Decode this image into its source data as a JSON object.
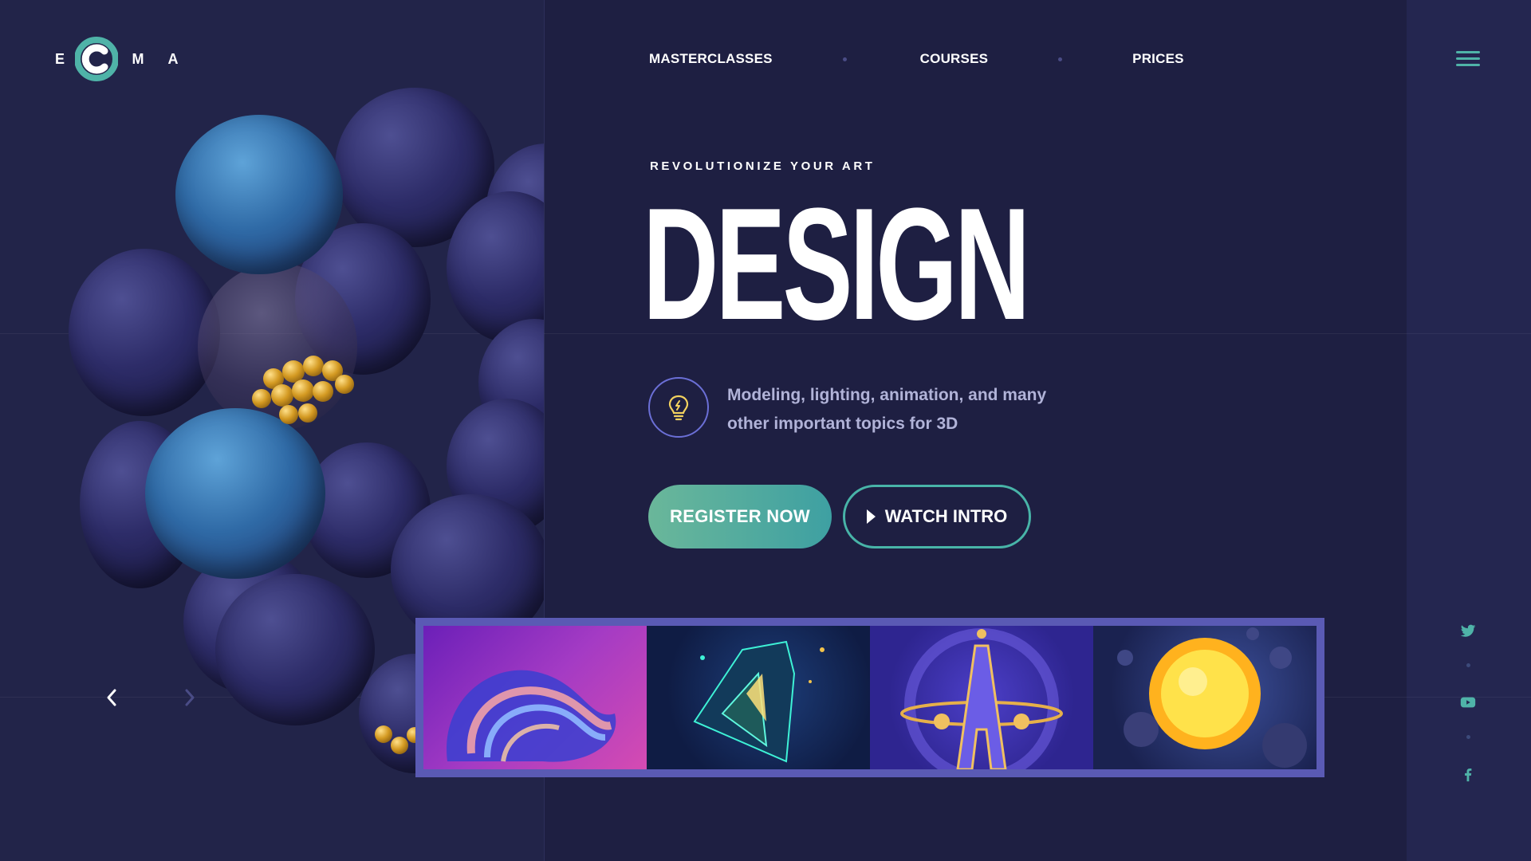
{
  "logo": {
    "letters": [
      "E",
      "M",
      "A"
    ]
  },
  "nav": {
    "items": [
      {
        "label": "MASTERCLASSES"
      },
      {
        "label": "COURSES"
      },
      {
        "label": "PRICES"
      }
    ]
  },
  "hero": {
    "eyebrow": "REVOLUTIONIZE YOUR ART",
    "title": "DESIGN",
    "description": "Modeling, lighting, animation, and many other important topics for 3D",
    "register_label": "REGISTER NOW",
    "watch_label": "WATCH INTRO"
  },
  "gallery": {
    "thumbnails": [
      "abstract-ribbon",
      "neon-crystal",
      "letter-a-sculpture",
      "glowing-sphere"
    ]
  },
  "slider": {
    "prev_icon": "chevron-left-icon",
    "next_icon": "chevron-right-icon"
  },
  "social": [
    "twitter-icon",
    "youtube-icon",
    "facebook-icon"
  ],
  "colors": {
    "background": "#1e1f42",
    "accent": "#48b4a8",
    "gallery_frame": "#5a5ab4",
    "description_text": "#b1b3d8"
  }
}
